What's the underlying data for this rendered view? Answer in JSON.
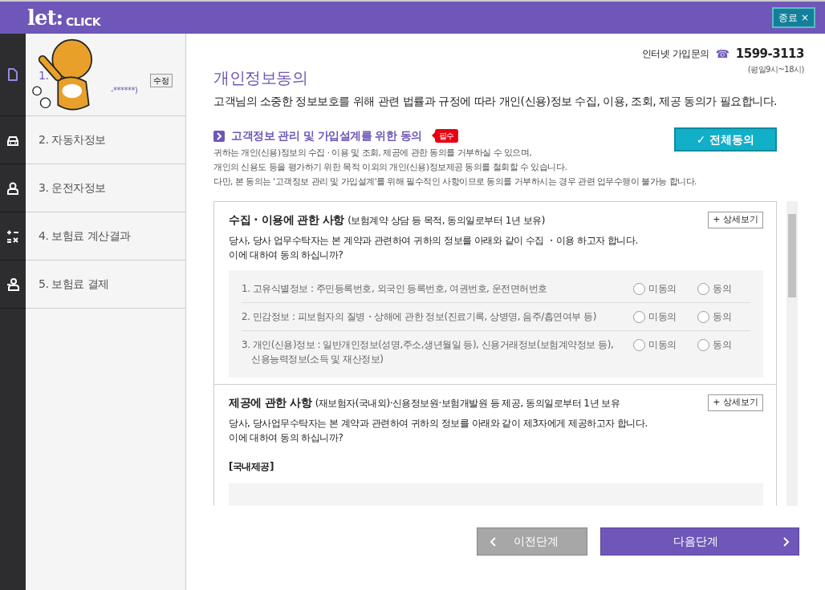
{
  "header": {
    "logo_main": "let:",
    "logo_sub": "CLICK",
    "close_button": "종료 ×"
  },
  "sidebar": {
    "items": [
      {
        "label": "1.",
        "sub": "-******)",
        "edit_button": "수정",
        "selected": true
      },
      {
        "label": "2. 자동차정보",
        "selected": false
      },
      {
        "label": "3. 운전자정보",
        "selected": false
      },
      {
        "label": "4. 보험료 계산결과",
        "selected": false
      },
      {
        "label": "5. 보험료 결제",
        "selected": false
      }
    ]
  },
  "contact": {
    "label": "인터넷 가입문의",
    "phone_icon": "☎",
    "phone": "1599-3113",
    "hours": "(평일9시~18시)"
  },
  "title": "개인정보동의",
  "subtitle": "고객님의 소중한 정보보호를 위해 관련 법률과 규정에 따라 개인(신용)정보 수집, 이용, 조회, 제공 동의가 필요합니다.",
  "consent": {
    "heading": "고객정보 관리 및 가입설계를 위한 동의",
    "required_badge": "필수",
    "agree_all_button": "✓ 전체동의",
    "notes": [
      "귀하는 개인(신용)정보의 수집 · 이용 및 조회, 제공에 관한 동의를 거부하실 수 있으며,",
      "개인의 신용도 등을 평가하기 위한 목적 이외의 개인(신용)정보제공 동의를 철회할 수 있습니다.",
      "다만, 본 동의는 '고객정보 관리 및 가입설계'를 위해 필수적인 사항이므로 동의를 거부하시는 경우 관련 업무수행이 불가능 합니다."
    ],
    "sections": [
      {
        "title": "수집 · 이용에 관한 사항",
        "title_note": "(보험계약 상담 등 목적, 동의일로부터 1년 보유)",
        "detail_button": "+ 상세보기",
        "question": [
          "당사, 당사 업무수탁자는 본 계약과 관련하여 귀하의 정보를 아래와 같이 수집 ・이용 하고자 합니다.",
          "이에 대하여 동의 하십니까?"
        ],
        "items": [
          {
            "text": "1. 고유식별정보 : 주민등록번호, 외국인 등록번호, 여권번호, 운전면허번호",
            "options": [
              {
                "label": "미동의",
                "selected": false
              },
              {
                "label": "동의",
                "selected": false
              }
            ]
          },
          {
            "text": "2. 민감정보 : 피보험자의 질병・상해에 관한 정보(진료기록, 상병명, 음주/흡연여부 등)",
            "options": [
              {
                "label": "미동의",
                "selected": false
              },
              {
                "label": "동의",
                "selected": false
              }
            ]
          },
          {
            "text": "3. 개인(신용)정보 : 일반개인정보(성명,주소,생년월일 등), 신용거래정보(보험계약정보 등), 신용능력정보(소득 및 재산정보)",
            "options": [
              {
                "label": "미동의",
                "selected": false
              },
              {
                "label": "동의",
                "selected": false
              }
            ]
          }
        ]
      },
      {
        "title": "제공에 관한 사항",
        "title_note": "(재보험자(국내외)·신용정보원·보험개발원 등 제공, 동의일로부터 1년 보유",
        "detail_button": "+ 상세보기",
        "question": [
          "당사, 당사업무수탁자는 본 계약과 관련하여 귀하의 정보를 아래와 같이 제3자에게 제공하고자 합니다.",
          "이에 대하여 동의 하십니까?"
        ],
        "subheading": "[국내제공]"
      }
    ]
  },
  "nav": {
    "prev_button": "이전단계",
    "next_button": "다음단계"
  }
}
